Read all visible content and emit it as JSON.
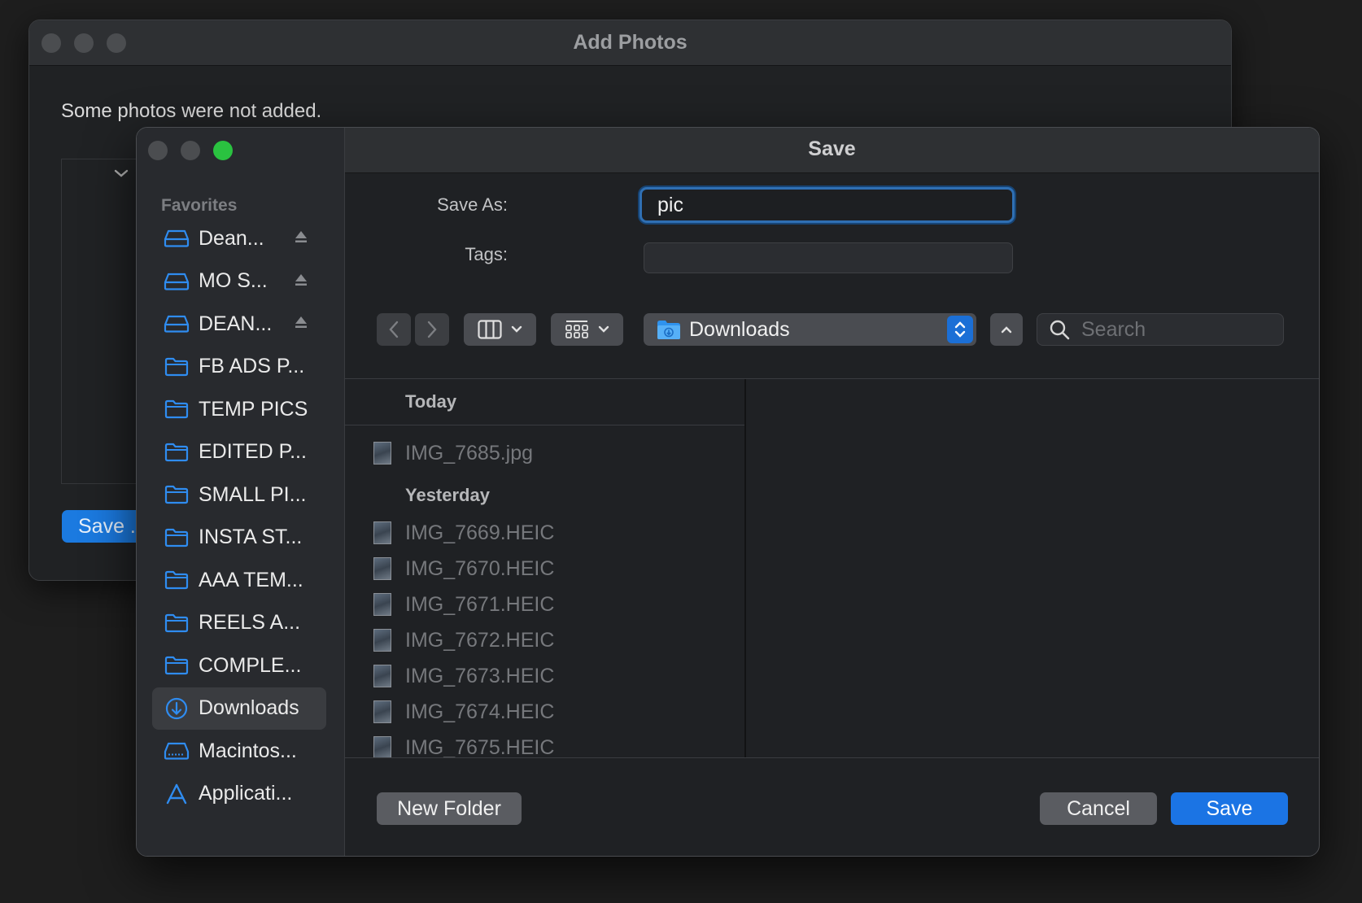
{
  "background_window": {
    "title": "Add Photos",
    "message": "Some photos were not added.",
    "save_button": "Save ."
  },
  "dialog": {
    "title": "Save",
    "save_as_label": "Save As:",
    "save_as_value": "pic",
    "tags_label": "Tags:",
    "location": "Downloads",
    "search_placeholder": "Search",
    "sidebar": {
      "heading": "Favorites",
      "items": [
        {
          "label": "Dean...",
          "icon": "drive-icon"
        },
        {
          "label": "MO S...",
          "icon": "drive-icon"
        },
        {
          "label": "DEAN...",
          "icon": "drive-icon"
        },
        {
          "label": "FB ADS P...",
          "icon": "folder-icon"
        },
        {
          "label": "TEMP PICS",
          "icon": "folder-icon"
        },
        {
          "label": "EDITED P...",
          "icon": "folder-icon"
        },
        {
          "label": "SMALL PI...",
          "icon": "folder-icon"
        },
        {
          "label": "INSTA ST...",
          "icon": "folder-icon"
        },
        {
          "label": "AAA TEM...",
          "icon": "folder-icon"
        },
        {
          "label": "REELS A...",
          "icon": "folder-icon"
        },
        {
          "label": "COMPLE...",
          "icon": "folder-icon"
        },
        {
          "label": "Downloads",
          "icon": "downloads-icon"
        },
        {
          "label": "Macintos...",
          "icon": "hard-disk-icon"
        },
        {
          "label": "Applicati...",
          "icon": "applications-icon"
        }
      ]
    },
    "files": {
      "today_header": "Today",
      "today": [
        "IMG_7685.jpg"
      ],
      "yesterday_header": "Yesterday",
      "yesterday": [
        "IMG_7669.HEIC",
        "IMG_7670.HEIC",
        "IMG_7671.HEIC",
        "IMG_7672.HEIC",
        "IMG_7673.HEIC",
        "IMG_7674.HEIC",
        "IMG_7675.HEIC"
      ]
    },
    "buttons": {
      "new_folder": "New Folder",
      "cancel": "Cancel",
      "save": "Save"
    }
  },
  "colors": {
    "accent": "#1b74e4",
    "folder_icon": "#2f8cf0"
  }
}
